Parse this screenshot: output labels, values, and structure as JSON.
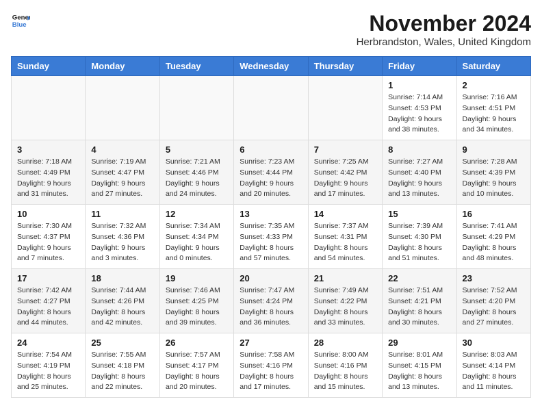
{
  "header": {
    "logo_line1": "General",
    "logo_line2": "Blue",
    "month_title": "November 2024",
    "location": "Herbrandston, Wales, United Kingdom"
  },
  "weekdays": [
    "Sunday",
    "Monday",
    "Tuesday",
    "Wednesday",
    "Thursday",
    "Friday",
    "Saturday"
  ],
  "weeks": [
    [
      {
        "day": "",
        "info": ""
      },
      {
        "day": "",
        "info": ""
      },
      {
        "day": "",
        "info": ""
      },
      {
        "day": "",
        "info": ""
      },
      {
        "day": "",
        "info": ""
      },
      {
        "day": "1",
        "info": "Sunrise: 7:14 AM\nSunset: 4:53 PM\nDaylight: 9 hours\nand 38 minutes."
      },
      {
        "day": "2",
        "info": "Sunrise: 7:16 AM\nSunset: 4:51 PM\nDaylight: 9 hours\nand 34 minutes."
      }
    ],
    [
      {
        "day": "3",
        "info": "Sunrise: 7:18 AM\nSunset: 4:49 PM\nDaylight: 9 hours\nand 31 minutes."
      },
      {
        "day": "4",
        "info": "Sunrise: 7:19 AM\nSunset: 4:47 PM\nDaylight: 9 hours\nand 27 minutes."
      },
      {
        "day": "5",
        "info": "Sunrise: 7:21 AM\nSunset: 4:46 PM\nDaylight: 9 hours\nand 24 minutes."
      },
      {
        "day": "6",
        "info": "Sunrise: 7:23 AM\nSunset: 4:44 PM\nDaylight: 9 hours\nand 20 minutes."
      },
      {
        "day": "7",
        "info": "Sunrise: 7:25 AM\nSunset: 4:42 PM\nDaylight: 9 hours\nand 17 minutes."
      },
      {
        "day": "8",
        "info": "Sunrise: 7:27 AM\nSunset: 4:40 PM\nDaylight: 9 hours\nand 13 minutes."
      },
      {
        "day": "9",
        "info": "Sunrise: 7:28 AM\nSunset: 4:39 PM\nDaylight: 9 hours\nand 10 minutes."
      }
    ],
    [
      {
        "day": "10",
        "info": "Sunrise: 7:30 AM\nSunset: 4:37 PM\nDaylight: 9 hours\nand 7 minutes."
      },
      {
        "day": "11",
        "info": "Sunrise: 7:32 AM\nSunset: 4:36 PM\nDaylight: 9 hours\nand 3 minutes."
      },
      {
        "day": "12",
        "info": "Sunrise: 7:34 AM\nSunset: 4:34 PM\nDaylight: 9 hours\nand 0 minutes."
      },
      {
        "day": "13",
        "info": "Sunrise: 7:35 AM\nSunset: 4:33 PM\nDaylight: 8 hours\nand 57 minutes."
      },
      {
        "day": "14",
        "info": "Sunrise: 7:37 AM\nSunset: 4:31 PM\nDaylight: 8 hours\nand 54 minutes."
      },
      {
        "day": "15",
        "info": "Sunrise: 7:39 AM\nSunset: 4:30 PM\nDaylight: 8 hours\nand 51 minutes."
      },
      {
        "day": "16",
        "info": "Sunrise: 7:41 AM\nSunset: 4:29 PM\nDaylight: 8 hours\nand 48 minutes."
      }
    ],
    [
      {
        "day": "17",
        "info": "Sunrise: 7:42 AM\nSunset: 4:27 PM\nDaylight: 8 hours\nand 44 minutes."
      },
      {
        "day": "18",
        "info": "Sunrise: 7:44 AM\nSunset: 4:26 PM\nDaylight: 8 hours\nand 42 minutes."
      },
      {
        "day": "19",
        "info": "Sunrise: 7:46 AM\nSunset: 4:25 PM\nDaylight: 8 hours\nand 39 minutes."
      },
      {
        "day": "20",
        "info": "Sunrise: 7:47 AM\nSunset: 4:24 PM\nDaylight: 8 hours\nand 36 minutes."
      },
      {
        "day": "21",
        "info": "Sunrise: 7:49 AM\nSunset: 4:22 PM\nDaylight: 8 hours\nand 33 minutes."
      },
      {
        "day": "22",
        "info": "Sunrise: 7:51 AM\nSunset: 4:21 PM\nDaylight: 8 hours\nand 30 minutes."
      },
      {
        "day": "23",
        "info": "Sunrise: 7:52 AM\nSunset: 4:20 PM\nDaylight: 8 hours\nand 27 minutes."
      }
    ],
    [
      {
        "day": "24",
        "info": "Sunrise: 7:54 AM\nSunset: 4:19 PM\nDaylight: 8 hours\nand 25 minutes."
      },
      {
        "day": "25",
        "info": "Sunrise: 7:55 AM\nSunset: 4:18 PM\nDaylight: 8 hours\nand 22 minutes."
      },
      {
        "day": "26",
        "info": "Sunrise: 7:57 AM\nSunset: 4:17 PM\nDaylight: 8 hours\nand 20 minutes."
      },
      {
        "day": "27",
        "info": "Sunrise: 7:58 AM\nSunset: 4:16 PM\nDaylight: 8 hours\nand 17 minutes."
      },
      {
        "day": "28",
        "info": "Sunrise: 8:00 AM\nSunset: 4:16 PM\nDaylight: 8 hours\nand 15 minutes."
      },
      {
        "day": "29",
        "info": "Sunrise: 8:01 AM\nSunset: 4:15 PM\nDaylight: 8 hours\nand 13 minutes."
      },
      {
        "day": "30",
        "info": "Sunrise: 8:03 AM\nSunset: 4:14 PM\nDaylight: 8 hours\nand 11 minutes."
      }
    ]
  ]
}
